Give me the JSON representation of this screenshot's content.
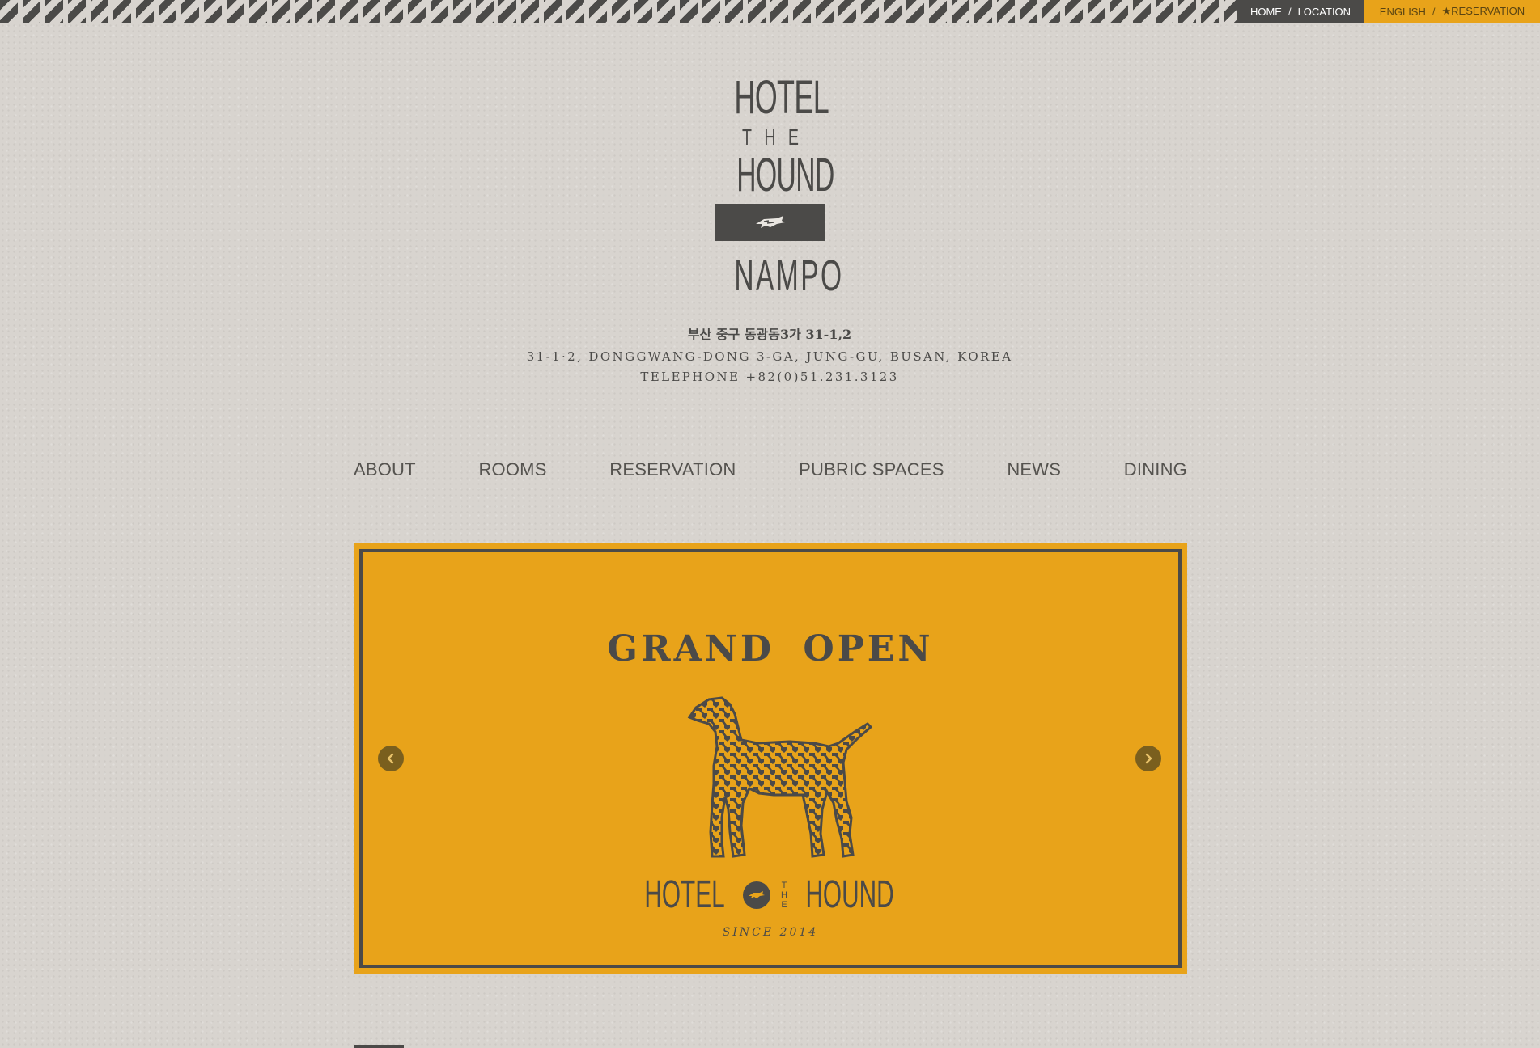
{
  "utility_nav": {
    "home": "HOME",
    "location": "LOCATION",
    "language": "ENGLISH",
    "reservation": "★RESERVATION",
    "separator": "/"
  },
  "logo": {
    "line1": "HOTEL",
    "line2": "THE",
    "line3": "HOUND",
    "line4": "NAMPO"
  },
  "address": {
    "korean": "부산 중구 동광동3가 31-1,2",
    "english": "31-1·2, DONGGWANG-DONG 3-GA, JUNG-GU, BUSAN, KOREA",
    "telephone": "TELEPHONE +82(0)51.231.3123"
  },
  "main_nav": {
    "items": [
      "ABOUT",
      "ROOMS",
      "RESERVATION",
      "PUBRIC SPACES",
      "NEWS",
      "DINING"
    ]
  },
  "banner": {
    "title": "GRAND OPEN",
    "brand_left": "HOTEL",
    "brand_the": [
      "T",
      "H",
      "E"
    ],
    "brand_right": "HOUND",
    "since": "SINCE 2014"
  },
  "colors": {
    "accent": "#e8a31a",
    "dark": "#4b4a48",
    "background": "#d8d4cf"
  },
  "icons": {
    "prev": "chevron-left-icon",
    "next": "chevron-right-icon",
    "emblem": "hound-emblem-icon",
    "dog": "hound-dog-illustration"
  }
}
